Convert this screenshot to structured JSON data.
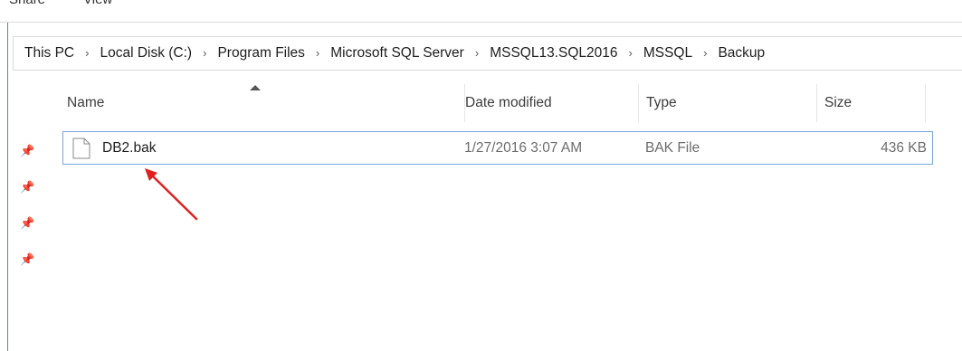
{
  "ribbon": {
    "tabs": [
      "Share",
      "View"
    ]
  },
  "breadcrumb": [
    "This PC",
    "Local Disk (C:)",
    "Program Files",
    "Microsoft SQL Server",
    "MSSQL13.SQL2016",
    "MSSQL",
    "Backup"
  ],
  "columns": {
    "name": "Name",
    "date": "Date modified",
    "type": "Type",
    "size": "Size"
  },
  "files": [
    {
      "name": "DB2.bak",
      "date": "1/27/2016 3:07 AM",
      "type": "BAK File",
      "size": "436 KB"
    }
  ],
  "colors": {
    "selection_border": "#7aa7d8",
    "annotation_arrow": "#e0201f",
    "window_border": "#5a86b8"
  },
  "icons": [
    "chevron-right-icon",
    "pin-icon",
    "file-icon",
    "sort-up-icon"
  ]
}
